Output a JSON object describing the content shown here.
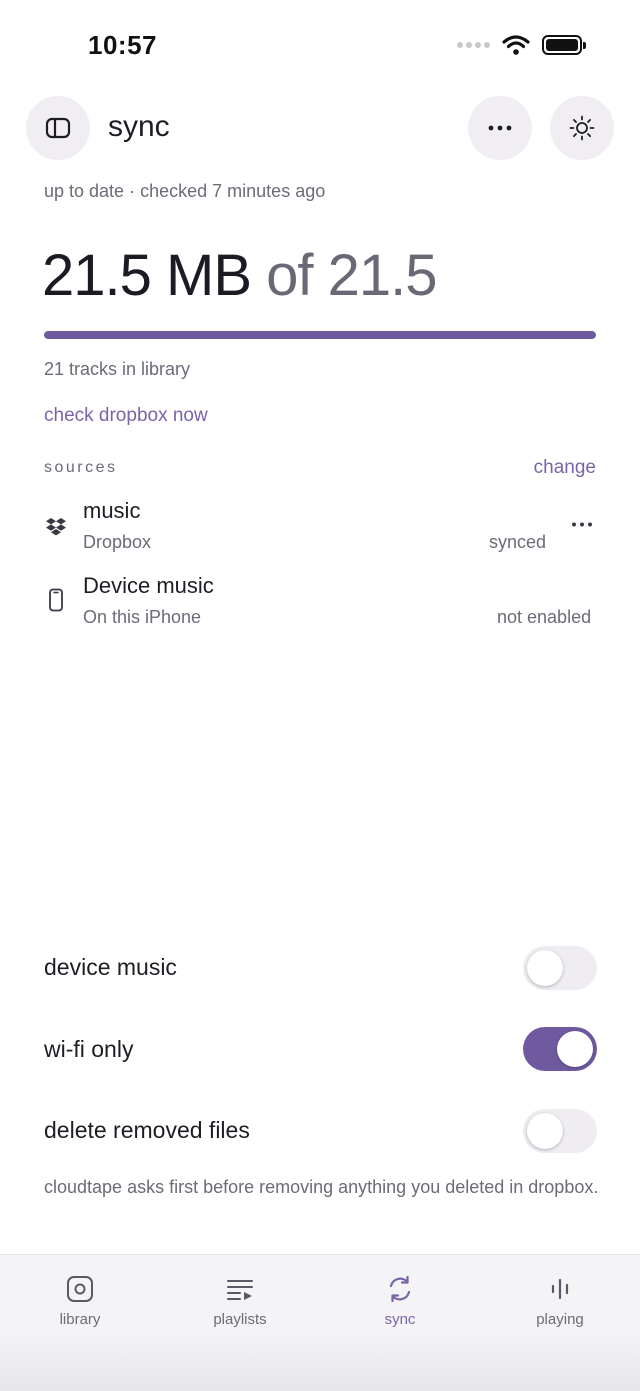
{
  "status_bar": {
    "time": "10:57"
  },
  "header": {
    "title": "sync",
    "sidebar_icon": "sidebar-toggle-icon",
    "more_icon": "ellipsis-icon",
    "theme_icon": "sun-icon"
  },
  "sync_status": {
    "state": "up to date",
    "separator": "·",
    "checked": "checked 7 minutes ago"
  },
  "storage": {
    "used_text": "21.5 MB",
    "total_text": "of 21.5",
    "progress_fraction": 1.0,
    "tracks": "21 tracks in library"
  },
  "actions": {
    "check_now": "check dropbox now"
  },
  "sources": {
    "label": "sources",
    "change": "change",
    "items": [
      {
        "name": "music",
        "provider": "Dropbox",
        "status": "synced",
        "icon": "dropbox-icon"
      },
      {
        "name": "Device music",
        "provider": "On this iPhone",
        "status": "not enabled",
        "icon": "phone-icon"
      }
    ]
  },
  "settings": [
    {
      "label": "device music",
      "enabled": false
    },
    {
      "label": "wi-fi only",
      "enabled": true
    },
    {
      "label": "delete removed files",
      "enabled": false
    }
  ],
  "note": "cloudtape asks first before removing anything you deleted in dropbox.",
  "tabs": [
    {
      "label": "library",
      "icon": "library-icon",
      "active": false
    },
    {
      "label": "playlists",
      "icon": "playlists-icon",
      "active": false
    },
    {
      "label": "sync",
      "icon": "sync-icon",
      "active": true
    },
    {
      "label": "playing",
      "icon": "equalizer-icon",
      "active": false
    }
  ],
  "colors": {
    "accent": "#6f5aa0",
    "accent_text": "#7a64a8",
    "muted": "#6e6a76",
    "button_bg": "#f0edf3"
  }
}
